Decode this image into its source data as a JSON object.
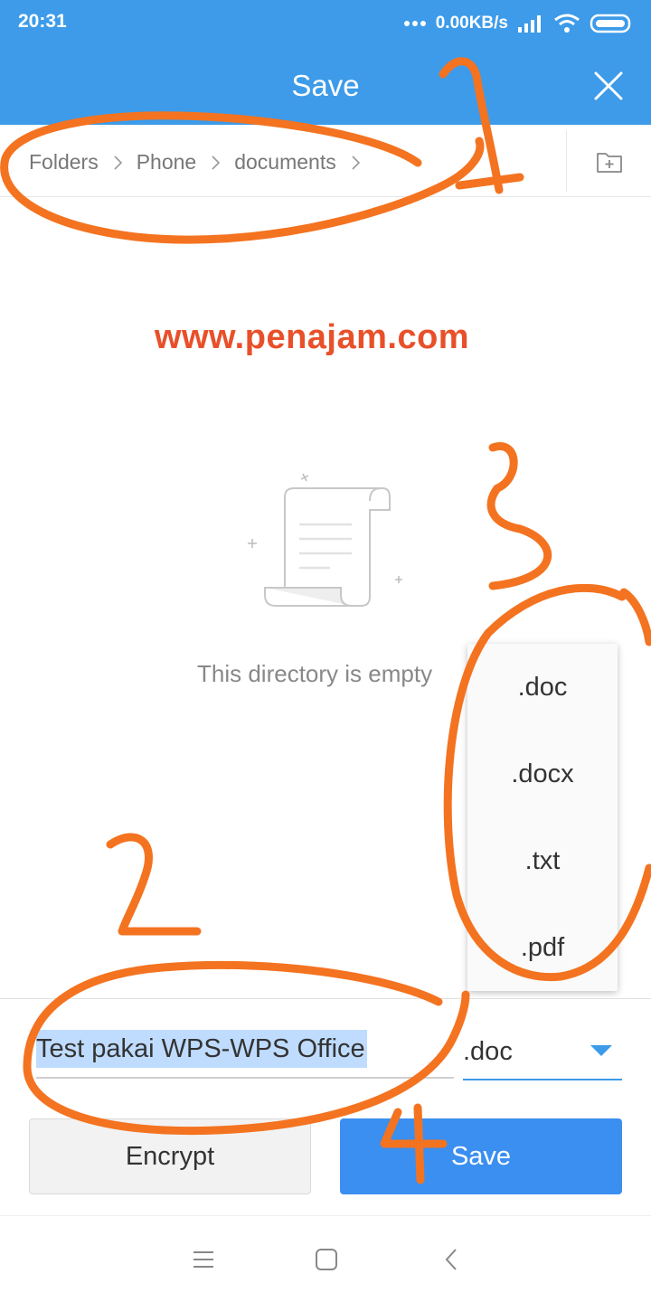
{
  "status_bar": {
    "time": "20:31",
    "network_speed": "0.00KB/s",
    "icons": [
      "more-dots-icon",
      "signal-icon",
      "wifi-icon",
      "battery-icon"
    ]
  },
  "header": {
    "title": "Save",
    "close_icon": "close-icon",
    "background_color": "#3d9be9"
  },
  "breadcrumb": {
    "items": [
      "Folders",
      "Phone",
      "documents"
    ],
    "new_folder_icon": "new-folder-icon"
  },
  "watermark": "www.penajam.com",
  "content": {
    "empty_message": "This directory is empty",
    "empty_icon": "document-scroll-icon"
  },
  "format_dropdown": {
    "options": [
      ".doc",
      ".docx",
      ".txt",
      ".pdf"
    ],
    "selected": ".doc"
  },
  "save_form": {
    "filename": "Test pakai WPS-WPS Office",
    "encrypt_label": "Encrypt",
    "save_label": "Save",
    "accent_color": "#3b8ff0"
  },
  "annotations": {
    "numbers": [
      "1",
      "2",
      "3",
      "4"
    ],
    "color": "#f47320"
  },
  "nav_bar": {
    "icons": [
      "menu-icon",
      "home-icon",
      "back-icon"
    ]
  }
}
